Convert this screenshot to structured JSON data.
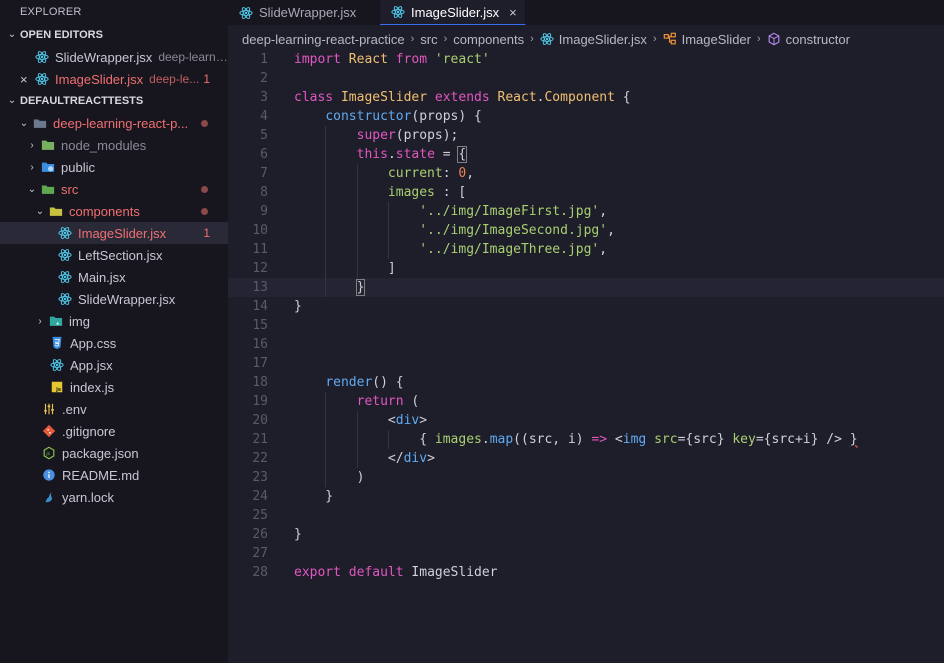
{
  "sidebar": {
    "title": "EXPLORER",
    "open_editors": {
      "header": "OPEN EDITORS",
      "items": [
        {
          "name": "SlideWrapper.jsx",
          "desc": "deep-learni...",
          "badge": ""
        },
        {
          "name": "ImageSlider.jsx",
          "desc": "deep-le...",
          "badge": "1"
        }
      ]
    },
    "workspace": {
      "header": "DEFAULTREACTTESTS",
      "root": "deep-learning-react-p...",
      "node_modules": "node_modules",
      "public": "public",
      "src": "src",
      "components": "components",
      "component_files": [
        {
          "name": "ImageSlider.jsx",
          "badge": "1"
        },
        {
          "name": "LeftSection.jsx",
          "badge": ""
        },
        {
          "name": "Main.jsx",
          "badge": ""
        },
        {
          "name": "SlideWrapper.jsx",
          "badge": ""
        }
      ],
      "img": "img",
      "src_files": [
        "App.css",
        "App.jsx",
        "index.js"
      ],
      "root_files": [
        ".env",
        ".gitignore",
        "package.json",
        "README.md",
        "yarn.lock"
      ]
    }
  },
  "tabs": [
    {
      "label": "SlideWrapper.jsx",
      "close": ""
    },
    {
      "label": "ImageSlider.jsx",
      "close": "×"
    }
  ],
  "breadcrumb": [
    "deep-learning-react-practice",
    "src",
    "components",
    "ImageSlider.jsx",
    "ImageSlider",
    "constructor"
  ],
  "editor": {
    "current_line": 13,
    "line_numbers": [
      "1",
      "2",
      "3",
      "4",
      "5",
      "6",
      "7",
      "8",
      "9",
      "10",
      "11",
      "12",
      "13",
      "14",
      "15",
      "16",
      "17",
      "18",
      "19",
      "20",
      "21",
      "22",
      "23",
      "24",
      "25",
      "26",
      "27",
      "28"
    ],
    "code": [
      "import React from 'react'",
      "",
      "class ImageSlider extends React.Component {",
      "    constructor(props) {",
      "        super(props);",
      "        this.state = {",
      "            current: 0,",
      "            images : [",
      "                '../img/ImageFirst.jpg',",
      "                '../img/ImageSecond.jpg',",
      "                '../img/ImageThree.jpg',",
      "            ]",
      "        }",
      "}",
      "",
      "",
      "",
      "    render() {",
      "        return (",
      "            <div>",
      "                { images.map((src, i) => <img src={src} key={src+i} /> }",
      "            </div>",
      "        )",
      "    }",
      "",
      "}",
      "",
      "export default ImageSlider"
    ]
  },
  "icons": {
    "react": "react-icon",
    "folder": "folder-icon",
    "css": "css3-icon",
    "js": "js-icon",
    "env": "settings-sliders-icon",
    "git": "git-icon",
    "npm": "json-icon",
    "info": "info-icon",
    "yarn": "yarn-icon"
  },
  "colors": {
    "react": "#4fc8e8",
    "error": "#f07070",
    "folder": "#6c7a90",
    "accent": "#3a6df0"
  }
}
